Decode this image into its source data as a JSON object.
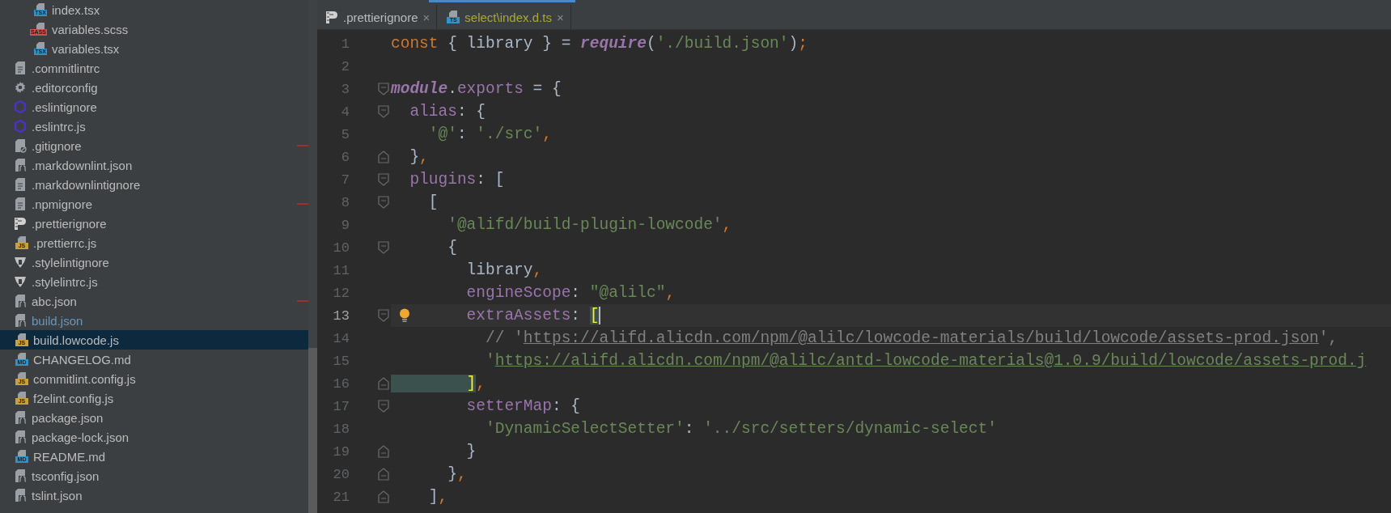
{
  "project_tree": {
    "items": [
      {
        "children": [
          {
            "name": "index.tsx",
            "kind": "tsx",
            "badge": "TSX",
            "selected": false,
            "modified": false,
            "marked": false
          },
          {
            "name": "variables.scss",
            "kind": "sass",
            "badge": "SASS",
            "selected": false,
            "modified": false,
            "marked": false
          },
          {
            "name": "variables.tsx",
            "kind": "tsx",
            "badge": "TSX",
            "selected": false,
            "modified": false,
            "marked": false
          }
        ]
      },
      {
        "name": ".commitlintrc",
        "kind": "text",
        "selected": false,
        "modified": false,
        "marked": false
      },
      {
        "name": ".editorconfig",
        "kind": "config",
        "selected": false,
        "modified": false,
        "marked": false
      },
      {
        "name": ".eslintignore",
        "kind": "eslint",
        "selected": false,
        "modified": false,
        "marked": false
      },
      {
        "name": ".eslintrc.js",
        "kind": "eslint",
        "selected": false,
        "modified": false,
        "marked": false
      },
      {
        "name": ".gitignore",
        "kind": "ignore",
        "selected": false,
        "modified": false,
        "marked": true
      },
      {
        "name": ".markdownlint.json",
        "kind": "json",
        "selected": false,
        "modified": false,
        "marked": false
      },
      {
        "name": ".markdownlintignore",
        "kind": "text",
        "selected": false,
        "modified": false,
        "marked": false
      },
      {
        "name": ".npmignore",
        "kind": "text",
        "selected": false,
        "modified": false,
        "marked": true
      },
      {
        "name": ".prettierignore",
        "kind": "prettier",
        "selected": false,
        "modified": false,
        "marked": false
      },
      {
        "name": ".prettierrc.js",
        "kind": "js",
        "badge": "JS",
        "selected": false,
        "modified": false,
        "marked": false
      },
      {
        "name": ".stylelintignore",
        "kind": "stylelint",
        "selected": false,
        "modified": false,
        "marked": false
      },
      {
        "name": ".stylelintrc.js",
        "kind": "stylelint",
        "selected": false,
        "modified": false,
        "marked": false
      },
      {
        "name": "abc.json",
        "kind": "json",
        "selected": false,
        "modified": false,
        "marked": true
      },
      {
        "name": "build.json",
        "kind": "json",
        "selected": false,
        "modified": true,
        "marked": false
      },
      {
        "name": "build.lowcode.js",
        "kind": "js",
        "badge": "JS",
        "selected": true,
        "modified": false,
        "marked": false
      },
      {
        "name": "CHANGELOG.md",
        "kind": "md",
        "badge": "MD",
        "selected": false,
        "modified": false,
        "marked": false
      },
      {
        "name": "commitlint.config.js",
        "kind": "js",
        "badge": "JS",
        "selected": false,
        "modified": false,
        "marked": false
      },
      {
        "name": "f2elint.config.js",
        "kind": "js",
        "badge": "JS",
        "selected": false,
        "modified": false,
        "marked": false
      },
      {
        "name": "package.json",
        "kind": "json",
        "selected": false,
        "modified": false,
        "marked": false
      },
      {
        "name": "package-lock.json",
        "kind": "json",
        "selected": false,
        "modified": false,
        "marked": false
      },
      {
        "name": "README.md",
        "kind": "md",
        "badge": "MD",
        "selected": false,
        "modified": false,
        "marked": false
      },
      {
        "name": "tsconfig.json",
        "kind": "json",
        "selected": false,
        "modified": false,
        "marked": false
      },
      {
        "name": "tslint.json",
        "kind": "json",
        "selected": false,
        "modified": false,
        "marked": false
      }
    ]
  },
  "editor_tabs": [
    {
      "label": ".prettierignore",
      "kind": "prettier",
      "unversioned": false,
      "close": "×"
    },
    {
      "label": "select\\index.d.ts",
      "kind": "ts",
      "badge": "TS",
      "unversioned": true,
      "close": "×"
    }
  ],
  "code_lines": [
    {
      "number": "1",
      "current": false,
      "tokens": [
        {
          "text": "const",
          "kind": "keyword"
        },
        {
          "text": " { library } = ",
          "kind": "plain"
        },
        {
          "text": "require",
          "kind": "builtin"
        },
        {
          "text": "(",
          "kind": "plain"
        },
        {
          "text": "'./build.json'",
          "kind": "string"
        },
        {
          "text": ")",
          "kind": "plain"
        },
        {
          "text": ";",
          "kind": "punct"
        }
      ]
    },
    {
      "number": "2",
      "current": false
    },
    {
      "number": "3",
      "current": false,
      "kind": "fold-start",
      "tokens": [
        {
          "text": "module",
          "kind": "builtin"
        },
        {
          "text": ".",
          "kind": "plain"
        },
        {
          "text": "exports",
          "kind": "prop"
        },
        {
          "text": " = {",
          "kind": "plain"
        }
      ]
    },
    {
      "number": "4",
      "current": false,
      "kind": "fold-start",
      "tokens": [
        {
          "text": "  alias",
          "kind": "prop"
        },
        {
          "text": ": {",
          "kind": "plain"
        }
      ]
    },
    {
      "number": "5",
      "current": false,
      "tokens": [
        {
          "text": "    '@'",
          "kind": "string"
        },
        {
          "text": ": ",
          "kind": "plain"
        },
        {
          "text": "'./src'",
          "kind": "string"
        },
        {
          "text": ",",
          "kind": "punct"
        }
      ]
    },
    {
      "number": "6",
      "current": false,
      "kind": "fold-end",
      "tokens": [
        {
          "text": "  }",
          "kind": "plain"
        },
        {
          "text": ",",
          "kind": "punct"
        }
      ]
    },
    {
      "number": "7",
      "current": false,
      "kind": "fold-start",
      "tokens": [
        {
          "text": "  plugins",
          "kind": "prop"
        },
        {
          "text": ": [",
          "kind": "plain"
        }
      ]
    },
    {
      "number": "8",
      "current": false,
      "kind": "fold-start",
      "tokens": [
        {
          "text": "    [",
          "kind": "plain"
        }
      ]
    },
    {
      "number": "9",
      "current": false,
      "tokens": [
        {
          "text": "      '@alifd/build-plugin-lowcode'",
          "kind": "string"
        },
        {
          "text": ",",
          "kind": "punct"
        }
      ]
    },
    {
      "number": "10",
      "current": false,
      "kind": "fold-start",
      "tokens": [
        {
          "text": "      {",
          "kind": "plain"
        }
      ]
    },
    {
      "number": "11",
      "current": false,
      "tokens": [
        {
          "text": "        library",
          "kind": "plain"
        },
        {
          "text": ",",
          "kind": "punct"
        }
      ]
    },
    {
      "number": "12",
      "current": false,
      "tokens": [
        {
          "text": "        engineScope",
          "kind": "prop"
        },
        {
          "text": ": ",
          "kind": "plain"
        },
        {
          "text": "\"@alilc\"",
          "kind": "string"
        },
        {
          "text": ",",
          "kind": "punct"
        }
      ]
    },
    {
      "number": "13",
      "current": true,
      "intention": true,
      "kind": "fold-start",
      "tokens": [
        {
          "text": "        extraAssets",
          "kind": "prop"
        },
        {
          "text": ": ",
          "kind": "plain"
        },
        {
          "text": "[",
          "kind": "match"
        }
      ]
    },
    {
      "number": "14",
      "current": false,
      "tokens": [
        {
          "text": "          // '",
          "kind": "comment"
        },
        {
          "text": "https://alifd.alicdn.com/npm/@alilc/lowcode-materials/build/lowcode/assets-prod.json",
          "kind": "comment-link"
        },
        {
          "text": "',",
          "kind": "comment"
        }
      ]
    },
    {
      "number": "15",
      "current": false,
      "tokens": [
        {
          "text": "          '",
          "kind": "string"
        },
        {
          "text": "https://alifd.alicdn.com/npm/@alilc/antd-lowcode-materials@1.0.9/build/lowcode/assets-prod.j",
          "kind": "link"
        }
      ]
    },
    {
      "number": "16",
      "current": false,
      "kind": "fold-end",
      "tokens": [
        {
          "text": "        ]",
          "kind": "match"
        },
        {
          "text": ",",
          "kind": "punct"
        }
      ]
    },
    {
      "number": "17",
      "current": false,
      "kind": "fold-start",
      "tokens": [
        {
          "text": "        setterMap",
          "kind": "prop"
        },
        {
          "text": ": {",
          "kind": "plain"
        }
      ]
    },
    {
      "number": "18",
      "current": false,
      "tokens": [
        {
          "text": "          'DynamicSelectSetter'",
          "kind": "string"
        },
        {
          "text": ": ",
          "kind": "plain"
        },
        {
          "text": "'../src/setters/dynamic-select'",
          "kind": "string"
        }
      ]
    },
    {
      "number": "19",
      "current": false,
      "kind": "fold-end",
      "tokens": [
        {
          "text": "        }",
          "kind": "plain"
        }
      ]
    },
    {
      "number": "20",
      "current": false,
      "kind": "fold-end",
      "tokens": [
        {
          "text": "      }",
          "kind": "plain"
        },
        {
          "text": ",",
          "kind": "punct"
        }
      ]
    },
    {
      "number": "21",
      "current": false,
      "kind": "fold-end",
      "tokens": [
        {
          "text": "    ]",
          "kind": "plain"
        },
        {
          "text": ",",
          "kind": "punct"
        }
      ]
    }
  ]
}
